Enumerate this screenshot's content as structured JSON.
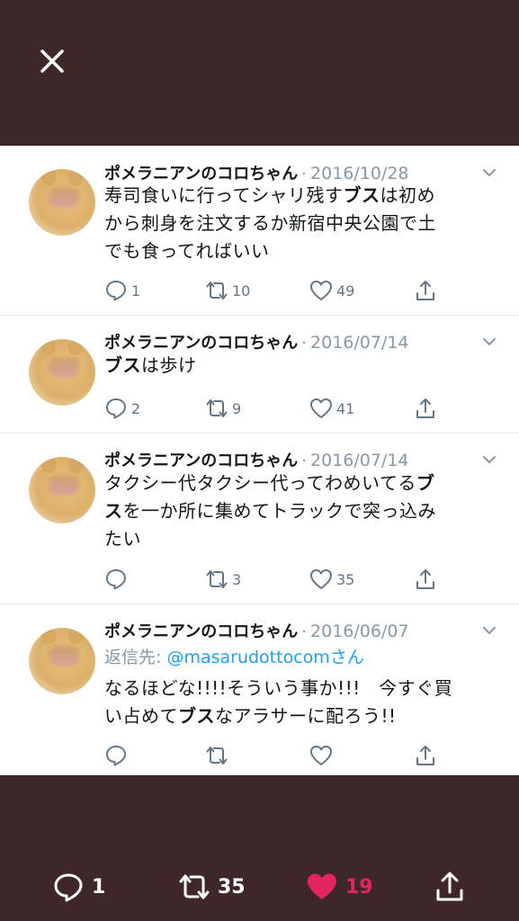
{
  "tweets": [
    {
      "name": "ポメラニアンのコロちゃん",
      "date": "2016/10/28",
      "lines": [
        [
          {
            "t": "寿司食いに行ってシャリ残す"
          },
          {
            "t": "ブス",
            "b": true
          },
          {
            "t": "は初め"
          }
        ],
        [
          {
            "t": "から刺身を注文するか新宿中央公園で土"
          }
        ],
        [
          {
            "t": "でも食ってればいい"
          }
        ]
      ],
      "replies": "1",
      "retweets": "10",
      "likes": "49"
    },
    {
      "name": "ポメラニアンのコロちゃん",
      "date": "2016/07/14",
      "lines": [
        [
          {
            "t": "ブス",
            "b": true
          },
          {
            "t": "は歩け"
          }
        ]
      ],
      "replies": "2",
      "retweets": "9",
      "likes": "41"
    },
    {
      "name": "ポメラニアンのコロちゃん",
      "date": "2016/07/14",
      "lines": [
        [
          {
            "t": "タクシー代タクシー代ってわめいてる"
          },
          {
            "t": "ブ",
            "b": true
          }
        ],
        [
          {
            "t": "ス",
            "b": true
          },
          {
            "t": "を一か所に集めてトラックで突っ込み"
          }
        ],
        [
          {
            "t": "たい"
          }
        ]
      ],
      "replies": "",
      "retweets": "3",
      "likes": "35"
    },
    {
      "name": "ポメラニアンのコロちゃん",
      "date": "2016/06/07",
      "reply_prefix": "返信先: ",
      "reply_handle": "@masarudottocomさん",
      "lines": [
        [
          {
            "t": "なるほどな!!!!そういう事か!!!　今すぐ買"
          }
        ],
        [
          {
            "t": "い占めて"
          },
          {
            "t": "ブス",
            "b": true
          },
          {
            "t": "なアラサーに配ろう!!"
          }
        ]
      ],
      "replies": "",
      "retweets": "",
      "likes": ""
    }
  ],
  "footer": {
    "replies": "1",
    "retweets": "35",
    "likes": "19",
    "like_color": "#e0245e"
  },
  "icons": {
    "close": "close-icon",
    "reply": "reply-icon",
    "retweet": "retweet-icon",
    "like": "heart-icon",
    "share": "share-icon",
    "menu": "chevron-down-icon"
  }
}
